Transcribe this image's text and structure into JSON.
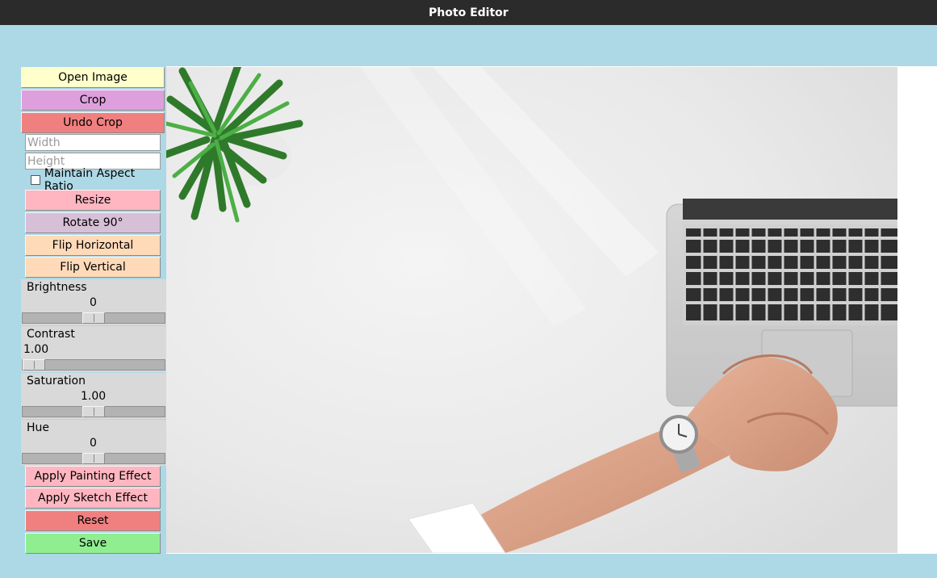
{
  "window": {
    "title": "Photo Editor"
  },
  "toolbar": {
    "open_image": "Open Image",
    "crop": "Crop",
    "undo_crop": "Undo Crop",
    "width_placeholder": "Width",
    "height_placeholder": "Height",
    "maintain_aspect_label": "Maintain Aspect Ratio",
    "maintain_aspect_checked": false,
    "resize": "Resize",
    "rotate": "Rotate 90°",
    "flip_horizontal": "Flip Horizontal",
    "flip_vertical": "Flip Vertical",
    "painting": "Apply Painting Effect",
    "sketch": "Apply Sketch Effect",
    "reset": "Reset",
    "save": "Save"
  },
  "adjustments": {
    "brightness": {
      "label": "Brightness",
      "value": "0",
      "level": 0.5
    },
    "contrast": {
      "label": "Contrast",
      "value": "1.00",
      "level": 0.0
    },
    "saturation": {
      "label": "Saturation",
      "value": "1.00",
      "level": 0.5
    },
    "hue": {
      "label": "Hue",
      "value": "0",
      "level": 0.5
    }
  },
  "colors": {
    "background": "#add8e6",
    "titlebar": "#2b2b2b",
    "open_image": "#ffffcc",
    "crop": "#dda0dd",
    "undo_crop": "#f08080",
    "resize": "#ffb6c1",
    "rotate": "#d8bfd8",
    "flip": "#ffdab9",
    "effect": "#ffb6c1",
    "reset": "#f08080",
    "save": "#90ee90",
    "scale_bg": "#d9d9d9"
  },
  "image": {
    "description_icon": "photo-desk-laptop-hands-plant"
  }
}
